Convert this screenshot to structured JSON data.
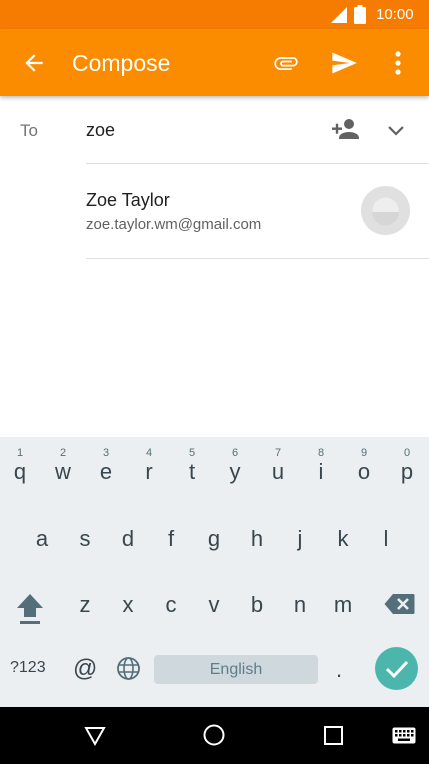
{
  "status": {
    "time": "10:00"
  },
  "app_bar": {
    "title": "Compose"
  },
  "compose": {
    "to_label": "To",
    "to_value": "zoe"
  },
  "suggestion": {
    "name": "Zoe Taylor",
    "email": "zoe.taylor.wm@gmail.com"
  },
  "keyboard": {
    "row1": [
      {
        "ch": "q",
        "hint": "1"
      },
      {
        "ch": "w",
        "hint": "2"
      },
      {
        "ch": "e",
        "hint": "3"
      },
      {
        "ch": "r",
        "hint": "4"
      },
      {
        "ch": "t",
        "hint": "5"
      },
      {
        "ch": "y",
        "hint": "6"
      },
      {
        "ch": "u",
        "hint": "7"
      },
      {
        "ch": "i",
        "hint": "8"
      },
      {
        "ch": "o",
        "hint": "9"
      },
      {
        "ch": "p",
        "hint": "0"
      }
    ],
    "row2": [
      "a",
      "s",
      "d",
      "f",
      "g",
      "h",
      "j",
      "k",
      "l"
    ],
    "row3": [
      "z",
      "x",
      "c",
      "v",
      "b",
      "n",
      "m"
    ],
    "symbols_label": "?123",
    "at_label": "@",
    "space_label": "English",
    "period_label": "."
  },
  "colors": {
    "status_bar": "#f57c00",
    "app_bar": "#fb8c00",
    "enter_key": "#4db6ac"
  }
}
